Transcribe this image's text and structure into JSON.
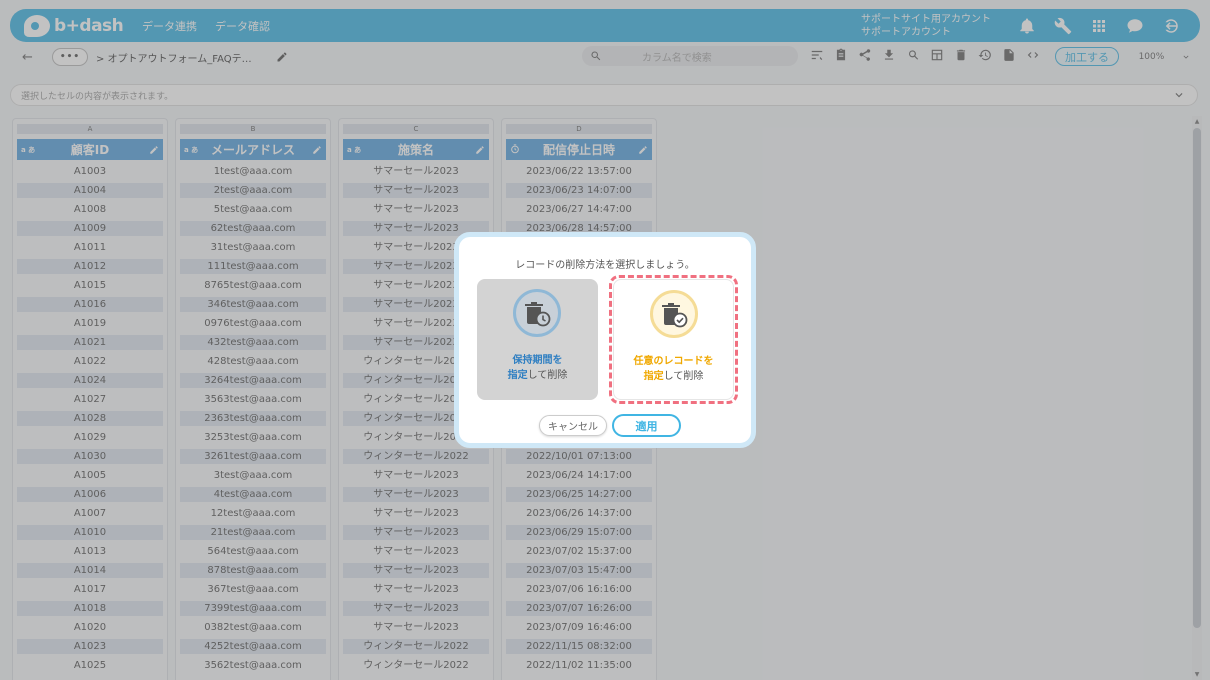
{
  "header": {
    "logo_text": "b+dash",
    "nav": [
      "データ連携",
      "データ確認"
    ],
    "account_line1": "サポートサイト用アカウント",
    "account_line2": "サポートアカウント"
  },
  "toolbar": {
    "back_label": "←",
    "more_label": "•••",
    "breadcrumb": "> オプトアウトフォーム_FAQテ…",
    "search_placeholder": "カラム名で検索",
    "process_label": "加工する",
    "zoom_value": "100%"
  },
  "cellbar": {
    "text": "選択したセルの内容が表示されます。"
  },
  "columns": [
    {
      "letter": "A",
      "type_label": "a あ",
      "name": "顧客ID",
      "values": [
        "A1003",
        "A1004",
        "A1008",
        "A1009",
        "A1011",
        "A1012",
        "A1015",
        "A1016",
        "A1019",
        "A1021",
        "A1022",
        "A1024",
        "A1027",
        "A1028",
        "A1029",
        "A1030",
        "A1005",
        "A1006",
        "A1007",
        "A1010",
        "A1013",
        "A1014",
        "A1017",
        "A1018",
        "A1020",
        "A1023",
        "A1025"
      ]
    },
    {
      "letter": "B",
      "type_label": "a あ",
      "name": "メールアドレス",
      "values": [
        "1test@aaa.com",
        "2test@aaa.com",
        "5test@aaa.com",
        "62test@aaa.com",
        "31test@aaa.com",
        "111test@aaa.com",
        "8765test@aaa.com",
        "346test@aaa.com",
        "0976test@aaa.com",
        "432test@aaa.com",
        "428test@aaa.com",
        "3264test@aaa.com",
        "3563test@aaa.com",
        "2363test@aaa.com",
        "3253test@aaa.com",
        "3261test@aaa.com",
        "3test@aaa.com",
        "4test@aaa.com",
        "12test@aaa.com",
        "21test@aaa.com",
        "564test@aaa.com",
        "878test@aaa.com",
        "367test@aaa.com",
        "7399test@aaa.com",
        "0382test@aaa.com",
        "4252test@aaa.com",
        "3562test@aaa.com"
      ]
    },
    {
      "letter": "C",
      "type_label": "a あ",
      "name": "施策名",
      "values": [
        "サマーセール2023",
        "サマーセール2023",
        "サマーセール2023",
        "サマーセール2023",
        "サマーセール2023",
        "サマーセール2023",
        "サマーセール2023",
        "サマーセール2023",
        "サマーセール2023",
        "サマーセール2023",
        "ウィンターセール2022",
        "ウィンターセール2022",
        "ウィンターセール2022",
        "ウィンターセール2022",
        "ウィンターセール2022",
        "ウィンターセール2022",
        "サマーセール2023",
        "サマーセール2023",
        "サマーセール2023",
        "サマーセール2023",
        "サマーセール2023",
        "サマーセール2023",
        "サマーセール2023",
        "サマーセール2023",
        "サマーセール2023",
        "ウィンターセール2022",
        "ウィンターセール2022"
      ]
    },
    {
      "letter": "D",
      "type_label": "",
      "name": "配信停止日時",
      "values": [
        "2023/06/22 13:57:00",
        "2023/06/23 14:07:00",
        "2023/06/27 14:47:00",
        "2023/06/28 14:57:00",
        "",
        "",
        "",
        "",
        "",
        "",
        "",
        "",
        "",
        "",
        "",
        "2022/10/01 07:13:00",
        "2023/06/24 14:17:00",
        "2023/06/25 14:27:00",
        "2023/06/26 14:37:00",
        "2023/06/29 15:07:00",
        "2023/07/02 15:37:00",
        "2023/07/03 15:47:00",
        "2023/07/06 16:16:00",
        "2023/07/07 16:26:00",
        "2023/07/09 16:46:00",
        "2022/11/15 08:32:00",
        "2022/11/02 11:35:00"
      ]
    }
  ],
  "modal": {
    "title": "レコードの削除方法を選択しましょう。",
    "option1_line1": "保持期間を",
    "option1_line2_strong": "指定",
    "option1_line2_rest": "して削除",
    "option2_line1": "任意のレコードを",
    "option2_line2_strong": "指定",
    "option2_line2_rest": "して削除",
    "cancel_label": "キャンセル",
    "apply_label": "適用"
  }
}
